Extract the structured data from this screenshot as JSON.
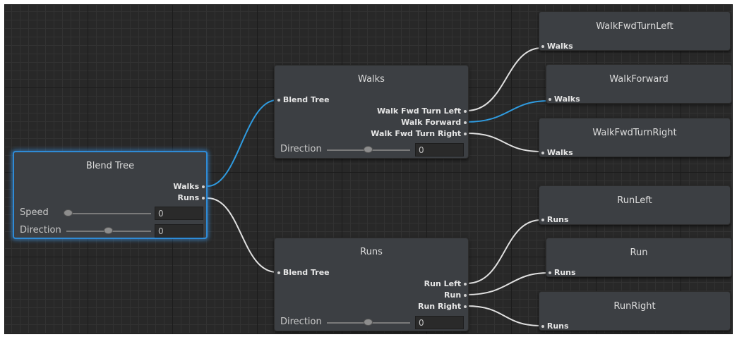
{
  "root": {
    "title": "Blend Tree",
    "outputs": [
      "Walks",
      "Runs"
    ],
    "params": [
      {
        "label": "Speed",
        "value": "0",
        "slider": 0.0
      },
      {
        "label": "Direction",
        "value": "0",
        "slider": 0.55
      }
    ]
  },
  "walks": {
    "title": "Walks",
    "input": "Blend Tree",
    "outputs": [
      "Walk Fwd Turn Left",
      "Walk Forward",
      "Walk Fwd Turn Right"
    ],
    "param": {
      "label": "Direction",
      "value": "0",
      "slider": 0.5
    }
  },
  "runs": {
    "title": "Runs",
    "input": "Blend Tree",
    "outputs": [
      "Run Left",
      "Run",
      "Run Right"
    ],
    "param": {
      "label": "Direction",
      "value": "0",
      "slider": 0.5
    }
  },
  "clips": [
    {
      "title": "WalkFwdTurnLeft",
      "input": "Walks"
    },
    {
      "title": "WalkForward",
      "input": "Walks"
    },
    {
      "title": "WalkFwdTurnRight",
      "input": "Walks"
    },
    {
      "title": "RunLeft",
      "input": "Runs"
    },
    {
      "title": "Run",
      "input": "Runs"
    },
    {
      "title": "RunRight",
      "input": "Runs"
    }
  ],
  "colors": {
    "selected_wire": "#2f9be0",
    "wire": "#e0e0e0",
    "node": "#3c3f43",
    "selection": "#2f8bd6"
  }
}
